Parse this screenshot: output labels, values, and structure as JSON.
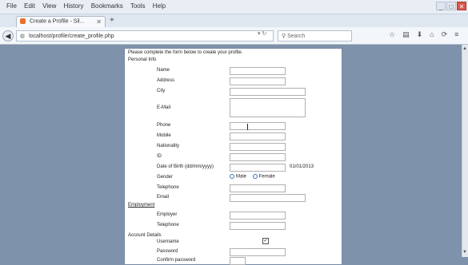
{
  "window": {
    "menu": [
      "File",
      "Edit",
      "View",
      "History",
      "Bookmarks",
      "Tools",
      "Help"
    ],
    "controls": {
      "minimize": "_",
      "maximize": "□",
      "close": "✕"
    }
  },
  "tab": {
    "title": "Create a Profile - Sil...",
    "close": "✕",
    "new_tab": "+"
  },
  "navbar": {
    "url": "localhost/profile/create_profile.php",
    "search_placeholder": "Search",
    "url_tools": "▾ ↻"
  },
  "form": {
    "intro": "Please complete the form below to create your profile.",
    "sections": {
      "personal": "Personal Info",
      "employment": "Employment",
      "account": "Account Details"
    },
    "labels": {
      "name": "Name",
      "address": "Address",
      "city": "City",
      "email": "E-Mail",
      "phone": "Phone",
      "mobile": "Mobile",
      "nationality": "Nationality",
      "id": "ID",
      "dob": "Date of Birth (dd/mm/yyyy)",
      "gender": "Gender",
      "telephone": "Telephone",
      "email2": "Email",
      "emp_name": "Employer",
      "emp_telephone": "Telephone",
      "username": "Username",
      "password": "Password",
      "confirm": "Confirm password"
    },
    "date_hint": "01/01/2013",
    "gender_options": [
      "Male",
      "Female"
    ],
    "checkbox_mark": "✓"
  }
}
